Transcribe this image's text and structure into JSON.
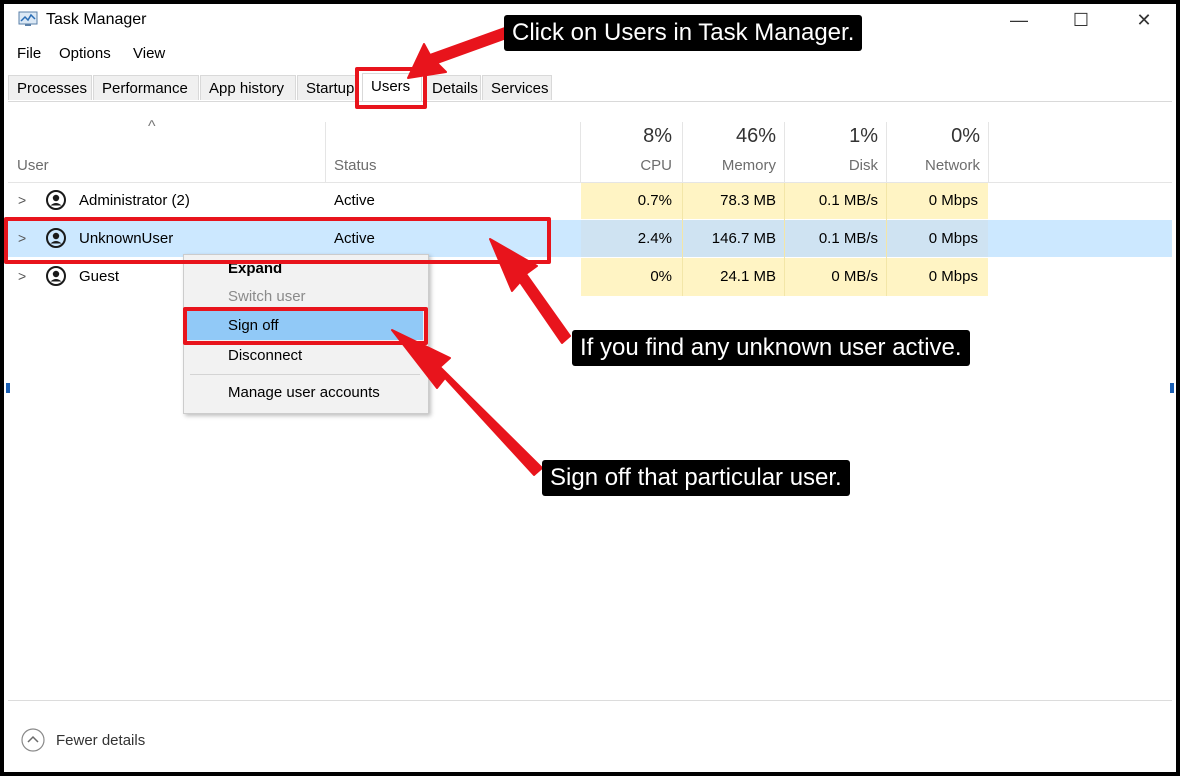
{
  "window": {
    "title": "Task Manager"
  },
  "window_controls": {
    "minimize": "—",
    "maximize": "☐",
    "close": "✕"
  },
  "menu": {
    "file": "File",
    "options": "Options",
    "view": "View"
  },
  "tabs": [
    "Processes",
    "Performance",
    "App history",
    "Startup",
    "Users",
    "Details",
    "Services"
  ],
  "active_tab": "Users",
  "table": {
    "sort_arrow": "^",
    "columns": {
      "user": "User",
      "status": "Status",
      "cpu": {
        "label": "CPU",
        "total": "8%"
      },
      "memory": {
        "label": "Memory",
        "total": "46%"
      },
      "disk": {
        "label": "Disk",
        "total": "1%"
      },
      "network": {
        "label": "Network",
        "total": "0%"
      }
    },
    "rows": [
      {
        "user": "Administrator (2)",
        "status": "Active",
        "cpu": "0.7%",
        "memory": "78.3 MB",
        "disk": "0.1 MB/s",
        "network": "0 Mbps"
      },
      {
        "user": "UnknownUser",
        "status": "Active",
        "cpu": "2.4%",
        "memory": "146.7 MB",
        "disk": "0.1 MB/s",
        "network": "0 Mbps"
      },
      {
        "user": "Guest",
        "status": "",
        "cpu": "0%",
        "memory": "24.1 MB",
        "disk": "0 MB/s",
        "network": "0 Mbps"
      }
    ]
  },
  "context_menu": {
    "expand": "Expand",
    "switch_user": "Switch user",
    "sign_off": "Sign off",
    "disconnect": "Disconnect",
    "manage": "Manage user accounts"
  },
  "footer": {
    "fewer_details": "Fewer details"
  },
  "annotations": {
    "click_users": "Click on Users in Task Manager.",
    "unknown_user": "If you find any unknown user active.",
    "sign_off": "Sign off that particular user."
  },
  "colors": {
    "annotation_red": "#e8141c",
    "heat_yellow": "#fff4c4",
    "selection_blue": "#cce8ff",
    "menu_highlight": "#91c9f7"
  },
  "icons": {
    "app": "task-manager-icon",
    "user": "user-avatar-icon",
    "expand": "chevron-right-icon",
    "fewer": "chevron-up-circle-icon"
  }
}
